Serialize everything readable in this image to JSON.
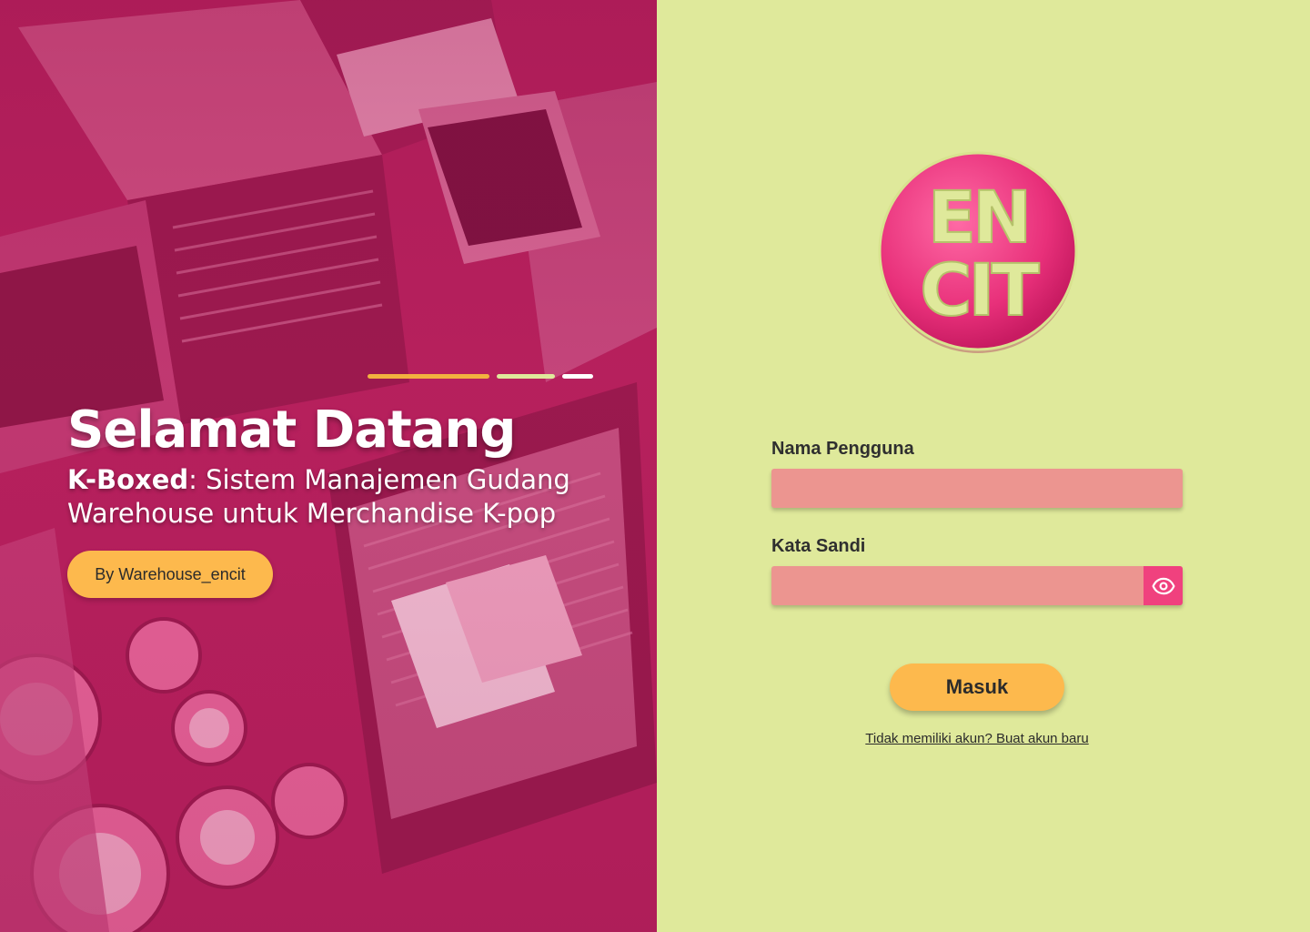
{
  "hero": {
    "title": "Selamat Datang",
    "subtitle_brand": "K-Boxed",
    "subtitle_line1_rest": ": Sistem Manajemen Gudang",
    "subtitle_line2": "Warehouse untuk Merchandise K-pop",
    "by_label": "By Warehouse_encit",
    "carousel_indicators": [
      "active",
      "inactive",
      "inactive"
    ],
    "colors": {
      "indicator_active": "#f2b23f",
      "indicator_2": "#dfe99b",
      "indicator_3": "#ffffff",
      "overlay": "#b8215e"
    }
  },
  "login": {
    "logo_text": [
      "EN",
      "CIT"
    ],
    "username_label": "Nama Pengguna",
    "username_value": "",
    "password_label": "Kata Sandi",
    "password_value": "",
    "toggle_icon": "eye-icon",
    "submit_label": "Masuk",
    "signup_link": "Tidak memiliki akun? Buat akun baru",
    "colors": {
      "background": "#dfe99b",
      "input": "#ec9590",
      "accent": "#f0417e",
      "button": "#fdb94d",
      "logo_bg": "#e8307a",
      "logo_text": "#dfe99b"
    }
  }
}
